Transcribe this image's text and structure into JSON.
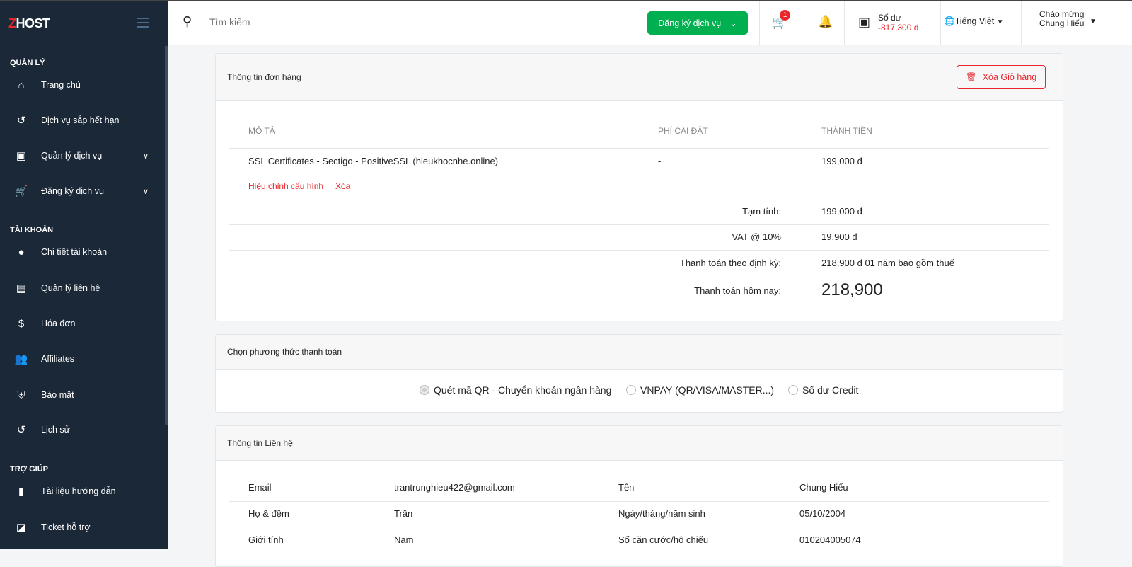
{
  "brand": {
    "logo_z": "Z",
    "logo_rest": "HOST"
  },
  "sidebar": {
    "sections": [
      "QUẢN LÝ",
      "TÀI KHOẢN",
      "TRỢ GIÚP"
    ],
    "items": [
      {
        "label": "Trang chủ",
        "icon": "home-icon"
      },
      {
        "label": "Dịch vụ sắp hết hạn",
        "icon": "history-icon"
      },
      {
        "label": "Quản lý dịch vụ",
        "icon": "account-box-icon"
      },
      {
        "label": "Đăng ký dịch vụ",
        "icon": "cart-icon"
      },
      {
        "label": "Chi tiết tài khoản",
        "icon": "person-icon"
      },
      {
        "label": "Quản lý liên hệ",
        "icon": "contacts-icon"
      },
      {
        "label": "Hóa đơn",
        "icon": "dollar-icon"
      },
      {
        "label": "Affiliates",
        "icon": "person-add-icon"
      },
      {
        "label": "Bảo mật",
        "icon": "shield-icon"
      },
      {
        "label": "Lịch sử",
        "icon": "history-icon"
      },
      {
        "label": "Tài liệu hướng dẫn",
        "icon": "document-icon"
      },
      {
        "label": "Ticket hỗ trợ",
        "icon": "ticket-icon"
      }
    ]
  },
  "topbar": {
    "search_placeholder": "Tìm kiếm",
    "register_label": "Đăng ký dịch vụ",
    "cart_count": "1",
    "balance_label": "Số dư",
    "balance_value": "-817,300 đ",
    "language": "Tiếng Việt",
    "greeting": "Chào mừng",
    "user_name": "Chung Hiếu"
  },
  "order": {
    "title": "Thông tin đơn hàng",
    "clear_cart": "Xóa Giỏ hàng",
    "headers": [
      "MÔ TẢ",
      "PHÍ CÀI ĐẶT",
      "THÀNH TIỀN"
    ],
    "item": {
      "desc": "SSL Certificates - Sectigo - PositiveSSL (hieukhocnhe.online)",
      "setup": "-",
      "price": "199,000 đ",
      "edit": "Hiệu chỉnh cấu hình",
      "remove": "Xóa"
    },
    "subtotal_label": "Tạm tính:",
    "subtotal": "199,000 đ",
    "vat_label": "VAT @ 10%",
    "vat": "19,900 đ",
    "recurring_label": "Thanh toán theo định kỳ:",
    "recurring": "218,900 đ 01 năm bao gồm thuế",
    "today_label": "Thanh toán hôm nay:",
    "today": "218,900"
  },
  "payment": {
    "title": "Chọn phương thức thanh toán",
    "options": [
      "Quét mã QR - Chuyển khoản ngân hàng",
      "VNPAY (QR/VISA/MASTER...)",
      "Số dư Credit"
    ],
    "selected": 0
  },
  "contact": {
    "title": "Thông tin Liên hệ",
    "rows": [
      [
        "Email",
        "trantrunghieu422@gmail.com",
        "Tên",
        "Chung Hiếu"
      ],
      [
        "Họ & đệm",
        "Trần",
        "Ngày/tháng/năm sinh",
        "05/10/2004"
      ],
      [
        "Giới tính",
        "Nam",
        "Số căn cước/hộ chiếu",
        "010204005074"
      ]
    ]
  }
}
